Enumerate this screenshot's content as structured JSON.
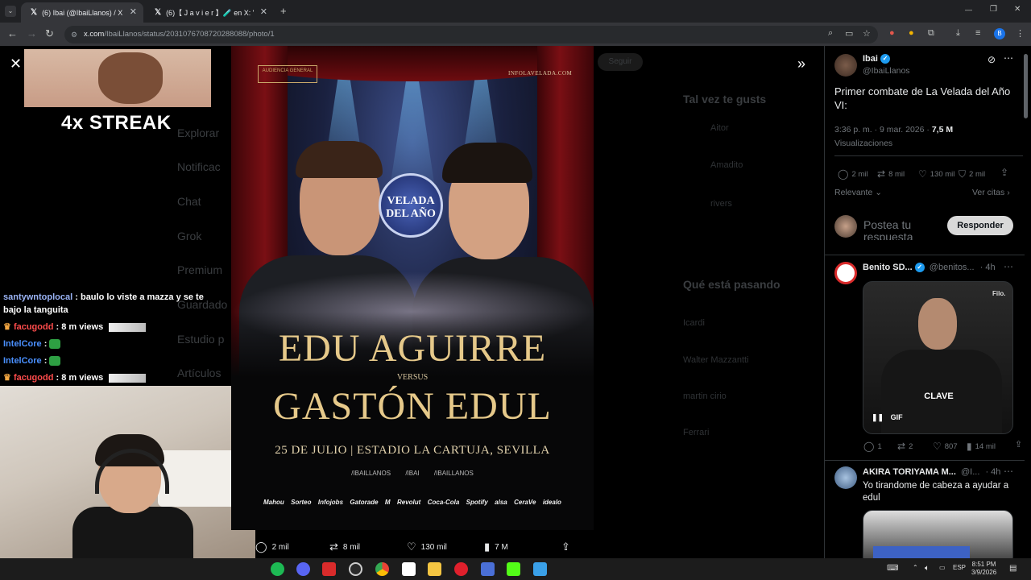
{
  "browser": {
    "tabs": [
      {
        "title": "(6) Ibai (@IbaiLlanos) / X",
        "active": true
      },
      {
        "title": "(6)【 J a v i e r 】🧪 en X: '",
        "active": false
      }
    ],
    "new_tab": "+",
    "url_host": "x.com",
    "url_path": "/IbaiLlanos/status/2031076708720288088/photo/1",
    "window_controls": [
      "—",
      "❐",
      "✕"
    ]
  },
  "background_nav": {
    "items": [
      "Explorar",
      "Notificac",
      "Chat",
      "Grok",
      "Premium",
      "Guardado",
      "Estudio p",
      "Artículos"
    ],
    "follow_label": "Seguir",
    "section_suggest": "Tal vez te gusts",
    "section_trending": "Qué está pasando",
    "trend_items": [
      "Icardi",
      "Walter Mazzantti",
      "martin cirio",
      "Ferrari"
    ],
    "suggest_items": [
      "Aitor",
      "Amadito",
      "rivers"
    ]
  },
  "stream_overlay": {
    "streak_text": "4x STREAK",
    "chat": [
      {
        "user": "santywntoplocal",
        "msg": ": baulo lo viste a mazza y se te bajo la tanguita",
        "color": "default"
      },
      {
        "user": "facugodd",
        "msg": ": 8 m views",
        "color": "red"
      },
      {
        "user": "IntelCore",
        "msg": ":",
        "color": "blue"
      },
      {
        "user": "IntelCore",
        "msg": ":",
        "color": "blue"
      },
      {
        "user": "facugodd",
        "msg": ": 8 m views",
        "color": "red"
      }
    ]
  },
  "poster": {
    "badge_top": "AUDIENCIA GENERAL",
    "site": "INFOLAVELADA.COM",
    "logo_text": "VELADA DEL AÑO",
    "fighter1": "EDU AGUIRRE",
    "versus": "VERSUS",
    "fighter2": "GASTÓN EDUL",
    "event_line": "25 DE JULIO | ESTADIO LA CARTUJA, SEVILLA",
    "socials": [
      "/IBAILLANOS",
      "/IBAI",
      "/IBAILLANOS"
    ],
    "sponsors": [
      "Mahou",
      "Sorteo",
      "Infojobs",
      "Gatorade",
      "M",
      "Revolut",
      "Coca-Cola",
      "Spotify",
      "alsa",
      "CeraVe",
      "idealo"
    ]
  },
  "action_bar": {
    "replies": "2 mil",
    "reposts": "8 mil",
    "likes": "130 mil",
    "views": "7 M"
  },
  "tweet": {
    "author": "Ibai",
    "handle": "@IbaiLlanos",
    "text": "Primer combate de La Velada del Año VI:",
    "time": "3:36 p. m. · 9 mar. 2026 ·",
    "views_count": "7,5 M",
    "views_label": "Visualizaciones",
    "replies": "2 mil",
    "reposts": "8 mil",
    "likes": "130 mil",
    "bookmarks": "2 mil",
    "sort_label": "Relevante",
    "quotes_label": "Ver citas",
    "reply_placeholder": "Postea tu respuesta",
    "reply_button": "Responder"
  },
  "replies": [
    {
      "author": "Benito SD...",
      "handle": "@benitos...",
      "age": "· 4h",
      "media_label": "CLAVE",
      "gif_label": "GIF",
      "watermark": "Filo.",
      "stats": {
        "replies": "1",
        "reposts": "2",
        "likes": "807",
        "views": "14 mil"
      }
    },
    {
      "author": "AKIRA TORIYAMA M...",
      "handle": "@I...",
      "age": "· 4h",
      "text": "Yo tirandome de cabeza a ayudar a edul"
    }
  ],
  "taskbar": {
    "lang": "ESP",
    "time": "8:51 PM",
    "date": "3/9/2026"
  }
}
